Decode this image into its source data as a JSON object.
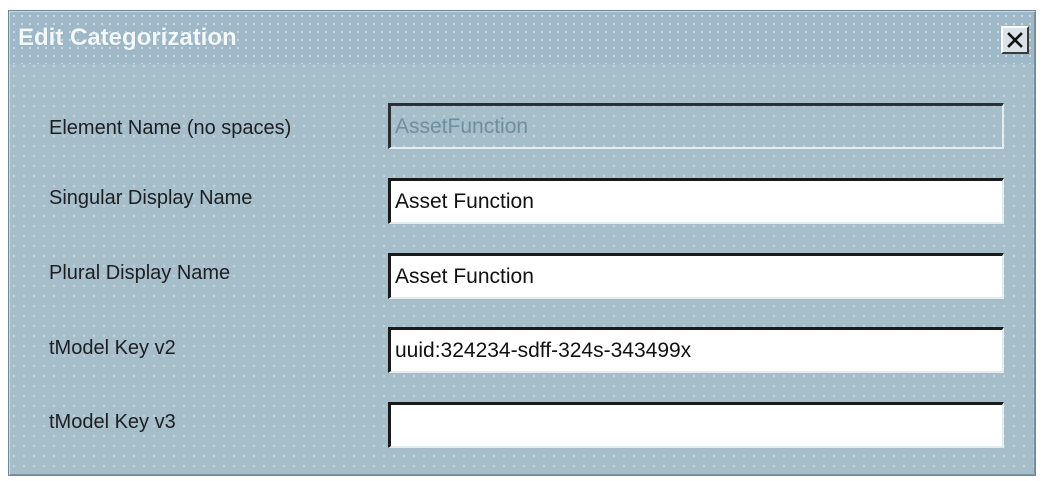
{
  "dialog": {
    "title": "Edit Categorization",
    "close_label": "×"
  },
  "fields": [
    {
      "label": "Element Name (no spaces)",
      "value": "AssetFunction",
      "disabled": true
    },
    {
      "label": "Singular Display Name",
      "value": "Asset Function",
      "disabled": false
    },
    {
      "label": "Plural Display Name",
      "value": "Asset Function",
      "disabled": false
    },
    {
      "label": "tModel Key v2",
      "value": "uuid:324234-sdff-324s-343499x",
      "disabled": false
    },
    {
      "label": "tModel Key v3",
      "value": "",
      "disabled": false
    }
  ],
  "colors": {
    "dialog_background": "#a6bdca",
    "title_text": "#f3f8fb",
    "disabled_text": "#6d8fa3"
  },
  "icons": {
    "close": "close-icon"
  }
}
